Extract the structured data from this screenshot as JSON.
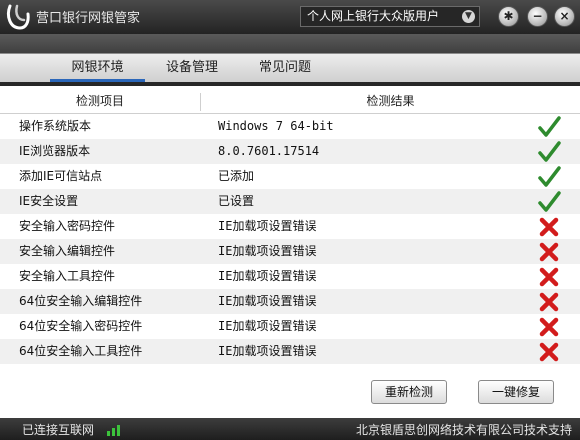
{
  "app": {
    "title": "营口银行网银管家"
  },
  "user_selector": {
    "value": "个人网上银行大众版用户",
    "caret_icon": "chevron-down-icon"
  },
  "window_buttons": [
    {
      "name": "pin-icon",
      "glyph": "✱"
    },
    {
      "name": "minimize-icon",
      "glyph": "−"
    },
    {
      "name": "close-icon",
      "glyph": "×"
    }
  ],
  "tabs": [
    {
      "label": "网银环境",
      "active": true
    },
    {
      "label": "设备管理",
      "active": false
    },
    {
      "label": "常见问题",
      "active": false
    }
  ],
  "table": {
    "headers": {
      "item": "检测项目",
      "result": "检测结果"
    },
    "rows": [
      {
        "item": "操作系统版本",
        "result": "Windows 7 64-bit",
        "status": "ok"
      },
      {
        "item": "IE浏览器版本",
        "result": "8.0.7601.17514",
        "status": "ok"
      },
      {
        "item": "添加IE可信站点",
        "result": "已添加",
        "status": "ok"
      },
      {
        "item": "IE安全设置",
        "result": "已设置",
        "status": "ok"
      },
      {
        "item": "安全输入密码控件",
        "result": "IE加载项设置错误",
        "status": "error"
      },
      {
        "item": "安全输入编辑控件",
        "result": "IE加载项设置错误",
        "status": "error"
      },
      {
        "item": "安全输入工具控件",
        "result": "IE加载项设置错误",
        "status": "error"
      },
      {
        "item": "64位安全输入编辑控件",
        "result": "IE加载项设置错误",
        "status": "error"
      },
      {
        "item": "64位安全输入密码控件",
        "result": "IE加载项设置错误",
        "status": "error"
      },
      {
        "item": "64位安全输入工具控件",
        "result": "IE加载项设置错误",
        "status": "error"
      }
    ]
  },
  "buttons": {
    "redetect": "重新检测",
    "repair": "一键修复"
  },
  "status_bar": {
    "connection": "已连接互联网",
    "footer": "北京银盾思创网络技术有限公司技术支持"
  },
  "colors": {
    "ok": "#2e8b2e",
    "error": "#d21c1c",
    "accent": "#2a66b9"
  }
}
